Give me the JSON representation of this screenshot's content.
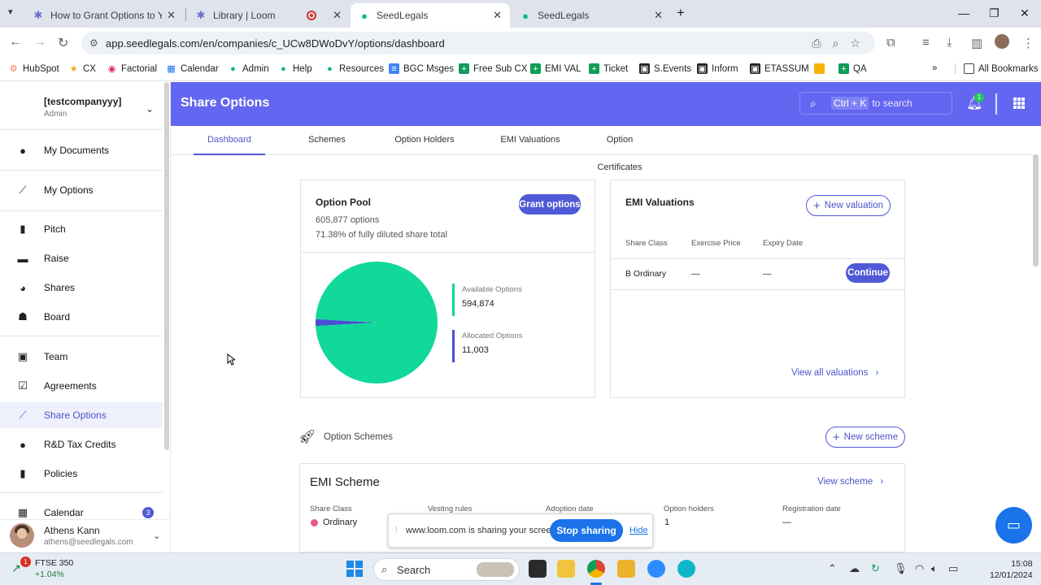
{
  "browser": {
    "tabs": [
      {
        "label": "How to Grant Options to Your T",
        "active": false
      },
      {
        "label": "Library | Loom",
        "active": false
      },
      {
        "label": "SeedLegals",
        "active": true
      },
      {
        "label": "SeedLegals",
        "active": false
      }
    ],
    "url": "app.seedlegals.com/en/companies/c_UCw8DWoDvY/options/dashboard",
    "bookmarks": [
      {
        "label": "HubSpot",
        "icon": "hubspot-icon",
        "color": "#ff7a59"
      },
      {
        "label": "CX",
        "icon": "star-icon",
        "color": "#f5a623"
      },
      {
        "label": "Factorial",
        "icon": "factorial-icon",
        "color": "#e0245e"
      },
      {
        "label": "Calendar",
        "icon": "calendar-icon",
        "color": "#1a73e8"
      },
      {
        "label": "Admin",
        "icon": "drop-icon",
        "color": "#10b981"
      },
      {
        "label": "Help",
        "icon": "drop-icon",
        "color": "#10b981"
      },
      {
        "label": "Resources",
        "icon": "drop-icon",
        "color": "#10b981"
      },
      {
        "label": "BGC Msges",
        "icon": "doc-icon",
        "color": "#4285f4"
      },
      {
        "label": "Free Sub CX",
        "icon": "sheet-icon",
        "color": "#0f9d58"
      },
      {
        "label": "EMI VAL",
        "icon": "sheet-icon",
        "color": "#0f9d58"
      },
      {
        "label": "Ticket",
        "icon": "sheet-icon",
        "color": "#0f9d58"
      },
      {
        "label": "S.Events",
        "icon": "notion-icon",
        "color": "#000000"
      },
      {
        "label": "Inform",
        "icon": "notion-icon",
        "color": "#000000"
      },
      {
        "label": "ETASSUM",
        "icon": "notion-icon",
        "color": "#000000"
      },
      {
        "label": "",
        "icon": "slides-icon",
        "color": "#f4b400"
      },
      {
        "label": "QA",
        "icon": "sheet-icon",
        "color": "#0f9d58"
      }
    ],
    "all_bookmarks": "All Bookmarks"
  },
  "sidebar": {
    "company": "[testcompanyyy]",
    "role": "Admin",
    "items": [
      {
        "label": "My Documents",
        "icon": "documents-icon",
        "active": false
      },
      {
        "label": "My Options",
        "icon": "chart-line-icon",
        "active": false
      },
      {
        "label": "Pitch",
        "icon": "pitch-icon",
        "active": false
      },
      {
        "label": "Raise",
        "icon": "wallet-icon",
        "active": false
      },
      {
        "label": "Shares",
        "icon": "pie-icon",
        "active": false
      },
      {
        "label": "Board",
        "icon": "people-icon",
        "active": false
      },
      {
        "label": "Team",
        "icon": "badge-icon",
        "active": false
      },
      {
        "label": "Agreements",
        "icon": "clipboard-icon",
        "active": false
      },
      {
        "label": "Share Options",
        "icon": "chart-line-icon",
        "active": true
      },
      {
        "label": "R&D Tax Credits",
        "icon": "bulb-icon",
        "active": false
      },
      {
        "label": "Policies",
        "icon": "book-icon",
        "active": false
      },
      {
        "label": "Calendar",
        "icon": "calendar-icon",
        "active": false,
        "badge": "3"
      }
    ],
    "user": {
      "name": "Athens Kann",
      "email": "athens@seedlegals.com"
    }
  },
  "header": {
    "title": "Share Options",
    "search_kbd": "Ctrl + K",
    "search_text": "to search",
    "notification_count": "1"
  },
  "tabs": [
    "Dashboard",
    "Schemes",
    "Option Holders",
    "EMI Valuations",
    "Option Certificates"
  ],
  "option_pool": {
    "title": "Option Pool",
    "total": "605,877 options",
    "percent_text": "71.38% of fully diluted share total",
    "grant_button": "Grant options",
    "available_label": "Available Options",
    "available_value": "594,874",
    "allocated_label": "Allocated Options",
    "allocated_value": "11,003"
  },
  "chart_data": {
    "type": "pie",
    "categories": [
      "Available Options",
      "Allocated Options"
    ],
    "values": [
      594874,
      11003
    ],
    "colors": [
      "#10d99a",
      "#4b4fd6"
    ]
  },
  "emi": {
    "title": "EMI Valuations",
    "new_button": "New valuation",
    "columns": [
      "Share Class",
      "Exercise Price",
      "Expiry Date"
    ],
    "rows": [
      {
        "share_class": "B Ordinary",
        "exercise_price": "—",
        "expiry_date": "—",
        "action": "Continue"
      }
    ],
    "view_all": "View all valuations"
  },
  "schemes": {
    "section_title": "Option Schemes",
    "new_button": "New scheme",
    "card": {
      "title": "EMI Scheme",
      "view_link": "View scheme",
      "columns": [
        "Share Class",
        "Vesting rules",
        "Adoption date",
        "Option holders",
        "Registration date"
      ],
      "share_class": "Ordinary",
      "option_holders": "1",
      "registration_date": "—"
    }
  },
  "share_bar": {
    "text": "www.loom.com is sharing your screen.",
    "stop": "Stop sharing",
    "hide": "Hide"
  },
  "taskbar": {
    "ticker_name": "FTSE 350",
    "ticker_change": "+1.04%",
    "ticker_badge": "1",
    "search": "Search",
    "time": "15:08",
    "date": "12/01/2024"
  }
}
